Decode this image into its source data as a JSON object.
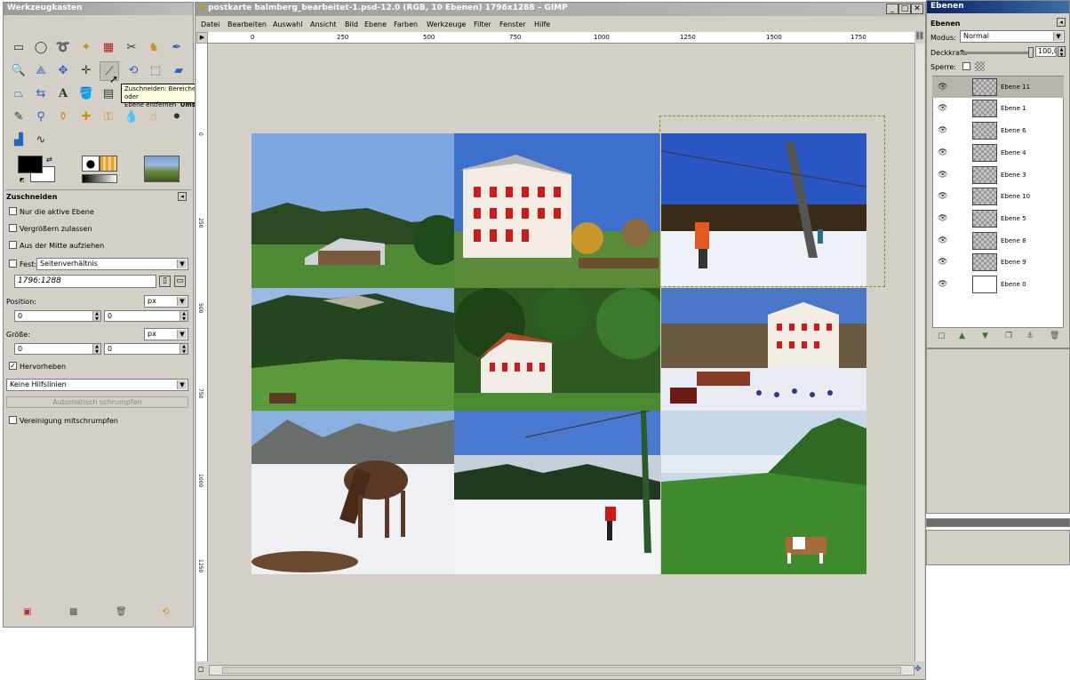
{
  "toolbox": {
    "title": "Werkzeugkasten",
    "section_title": "Zuschneiden",
    "options": {
      "only_active_layer": "Nur die aktive Ebene",
      "allow_growing": "Vergrößern zulassen",
      "expand_from_center": "Aus der Mitte aufziehen",
      "fixed_label": "Fest:",
      "fixed_value": "Seitenverhältnis",
      "ratio_value": "1796:1288",
      "position_label": "Position:",
      "position_unit": "px",
      "position_x": "0",
      "position_y": "0",
      "size_label": "Größe:",
      "size_unit": "px",
      "size_w": "0",
      "size_h": "0",
      "highlight_label": "Hervorheben",
      "guides_value": "Keine Hilfslinien",
      "autoshrink_button": "Automatisch schrumpfen",
      "shrink_merged": "Vereinigung mitschrumpfen"
    },
    "tooltip": {
      "line1": "Zuschneiden: Bereiche von Bild oder",
      "line2": "Ebene entfernen",
      "shortcut": "Umschalt+C"
    }
  },
  "image_window": {
    "title": "postkarte balmberg_bearbeitet-1.psd-12.0 (RGB, 10 Ebenen) 1796x1288 – GIMP",
    "menu": [
      "Datei",
      "Bearbeiten",
      "Auswahl",
      "Ansicht",
      "Bild",
      "Ebene",
      "Farben",
      "Werkzeuge",
      "Filter",
      "Fenster",
      "Hilfe"
    ],
    "ruler_ticks": [
      "0",
      "250",
      "500",
      "750",
      "1000",
      "1250",
      "1500",
      "1750"
    ],
    "vruler_ticks": [
      "0",
      "250",
      "500",
      "750",
      "1000",
      "1250"
    ]
  },
  "layers": {
    "title": "Ebenen",
    "tab": "Ebenen",
    "mode_label": "Modus:",
    "mode_value": "Normal",
    "opacity_label": "Deckkraft:",
    "opacity_value": "100,0",
    "lock_label": "Sperre:",
    "items": [
      {
        "name": "Ebene 11"
      },
      {
        "name": "Ebene 1"
      },
      {
        "name": "Ebene 6"
      },
      {
        "name": "Ebene 4"
      },
      {
        "name": "Ebene 3"
      },
      {
        "name": "Ebene 10"
      },
      {
        "name": "Ebene 5"
      },
      {
        "name": "Ebene 8"
      },
      {
        "name": "Ebene 9"
      },
      {
        "name": "Ebene 0"
      }
    ]
  },
  "colors": {
    "title_active": "#0a246a",
    "panel_bg": "#d4d0c8",
    "selection": "#b8b4aa"
  }
}
